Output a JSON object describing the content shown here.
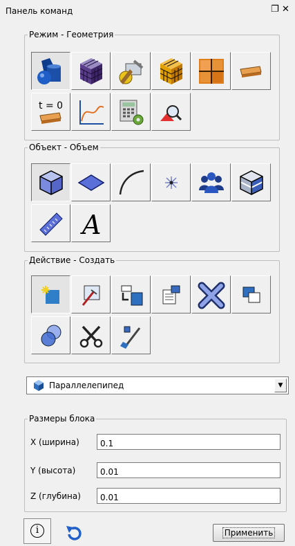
{
  "panel": {
    "title": "Панель команд",
    "float_icon": "restore-icon",
    "close_icon": "close-icon"
  },
  "groups": [
    {
      "legend": "Режим - Геометрия",
      "buttons": [
        {
          "icon": "geometry-shapes-icon"
        },
        {
          "icon": "mesh-cube-icon"
        },
        {
          "icon": "tools-icon"
        },
        {
          "icon": "mesh-grid-cube-icon"
        },
        {
          "icon": "grid-icon"
        },
        {
          "icon": "boundary-plate-icon"
        },
        {
          "icon": "initial-conditions-icon",
          "label": "t = 0"
        },
        {
          "icon": "graph-icon"
        },
        {
          "icon": "calculator-settings-icon"
        },
        {
          "icon": "zoom-view-icon"
        }
      ]
    },
    {
      "legend": "Объект - Объем",
      "buttons": [
        {
          "icon": "volume-cube-icon"
        },
        {
          "icon": "surface-icon"
        },
        {
          "icon": "curve-icon"
        },
        {
          "icon": "point-icon"
        },
        {
          "icon": "groups-icon"
        },
        {
          "icon": "assembly-icon"
        },
        {
          "icon": "ruler-icon"
        },
        {
          "icon": "text-icon",
          "label": "A"
        }
      ]
    },
    {
      "legend": "Действие - Создать",
      "buttons": [
        {
          "icon": "create-icon"
        },
        {
          "icon": "edit-icon"
        },
        {
          "icon": "move-icon"
        },
        {
          "icon": "properties-icon"
        },
        {
          "icon": "delete-icon"
        },
        {
          "icon": "copy-icon"
        },
        {
          "icon": "boolean-icon"
        },
        {
          "icon": "cut-icon"
        },
        {
          "icon": "paint-icon"
        }
      ]
    }
  ],
  "shape_select": {
    "icon": "box-icon",
    "value": "Параллелепипед"
  },
  "block_sizes": {
    "legend": "Размеры блока",
    "fields": [
      {
        "label": "X (ширина)",
        "value": "0.1"
      },
      {
        "label": "Y (высота)",
        "value": "0.01"
      },
      {
        "label": "Z (глубина)",
        "value": "0.01"
      }
    ]
  },
  "footer": {
    "info_icon": "info-icon",
    "info_glyph": "i",
    "reset_icon": "reset-icon",
    "apply_label": "Применить"
  }
}
